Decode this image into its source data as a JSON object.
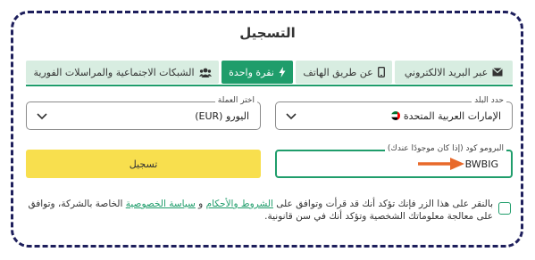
{
  "title": "التسجيل",
  "tabs": [
    {
      "label": "عبر البريد الالكتروني",
      "icon": "envelope-icon"
    },
    {
      "label": "عن طريق الهاتف",
      "icon": "phone-icon"
    },
    {
      "label": "نقرة واحدة",
      "icon": "lightning-icon"
    },
    {
      "label": "الشبكات الاجتماعية والمراسلات الفورية",
      "icon": "users-icon"
    }
  ],
  "country": {
    "label": "حدد البلد",
    "value": "الإمارات العربية المتحدة"
  },
  "currency": {
    "label": "اختر العملة",
    "value": "اليورو (EUR)"
  },
  "promo": {
    "label": "البرومو كود (إذا كان موجودًا عندك)",
    "value": "BWBIG"
  },
  "register_button": "تسجيل",
  "terms": {
    "before": "بالنقر على هذا الزر فإنك تؤكد أنك قد قرأت وتوافق على ",
    "link1": "الشروط والأحكام",
    "mid": " و ",
    "link2": "سياسة الخصوصية",
    "after": " الخاصة بالشركة، وتوافق على معالجة معلوماتك الشخصية وتؤكد أنك في سن قانونية."
  },
  "colors": {
    "accent": "#1f9d6b",
    "button": "#f8df4e",
    "arrow": "#e8692a",
    "frame": "#1e1f5c"
  }
}
